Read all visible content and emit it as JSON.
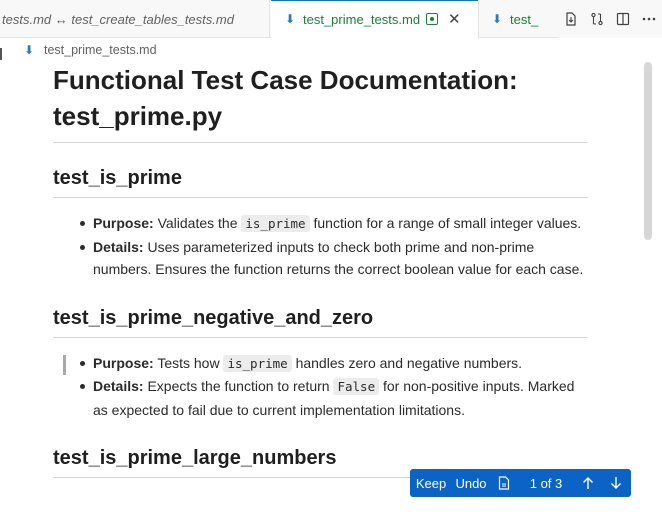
{
  "tabs": [
    {
      "label": "tests.md ↔ test_create_tables_tests.md",
      "active": false
    },
    {
      "label": "test_prime_tests.md",
      "active": true
    },
    {
      "label": "test_",
      "active": false
    }
  ],
  "tab_actions": [
    "open-changes-icon",
    "compare-icon",
    "split-editor-icon",
    "more-actions-icon"
  ],
  "breadcrumb": "test_prime_tests.md",
  "doc": {
    "title": "Functional Test Case Documentation: test_prime.py",
    "sections": [
      {
        "heading": "test_is_prime",
        "items": [
          {
            "label": "Purpose:",
            "pre": " Validates the ",
            "code": "is_prime",
            "post": " function for a range of small integer values."
          },
          {
            "label": "Details:",
            "pre": " Uses parameterized inputs to check both prime and non-prime numbers. Ensures the function returns the correct boolean value for each case.",
            "code": "",
            "post": ""
          }
        ]
      },
      {
        "heading": "test_is_prime_negative_and_zero",
        "items": [
          {
            "label": "Purpose:",
            "pre": " Tests how ",
            "code": "is_prime",
            "post": " handles zero and negative numbers."
          },
          {
            "label": "Details:",
            "pre": " Expects the function to return ",
            "code": "False",
            "post": " for non-positive inputs. Marked as expected to fail due to current implementation limitations."
          }
        ]
      },
      {
        "heading": "test_is_prime_large_numbers",
        "items": []
      }
    ]
  },
  "review_bar": {
    "keep": "Keep",
    "undo": "Undo",
    "counter": "1 of 3"
  },
  "colors": {
    "accent": "#0078d4",
    "tab_modified": "#1a7f37",
    "review_bar": "#0b63c5"
  }
}
